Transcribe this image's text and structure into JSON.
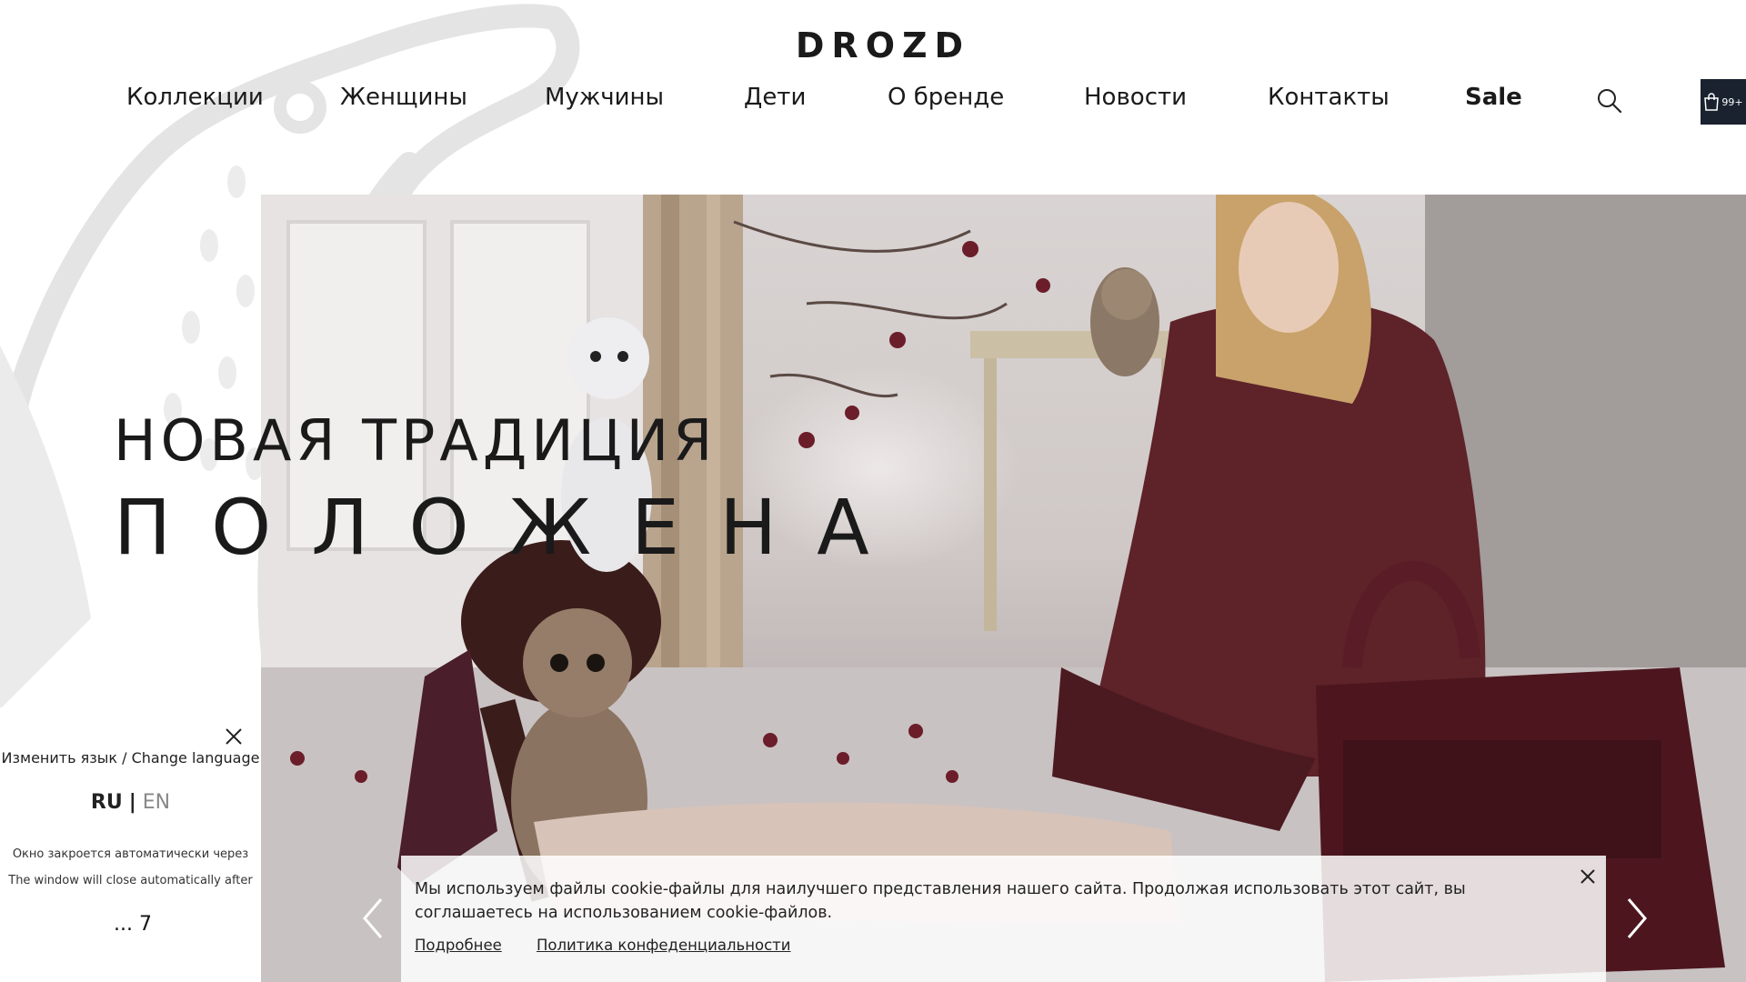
{
  "header": {
    "logo": "DROZD",
    "nav": [
      {
        "label": "Коллекции"
      },
      {
        "label": "Женщины"
      },
      {
        "label": "Мужчины"
      },
      {
        "label": "Дети"
      },
      {
        "label": "О бренде"
      },
      {
        "label": "Новости"
      },
      {
        "label": "Контакты"
      },
      {
        "label": "Sale"
      }
    ],
    "search_icon": "search-icon",
    "cart": {
      "icon": "shopping-bag-icon",
      "count": "99+"
    }
  },
  "hero": {
    "title_line1": "НОВАЯ ТРАДИЦИЯ",
    "title_line2": "ПОЛОЖЕНА",
    "prev_icon": "chevron-left-icon",
    "next_icon": "chevron-right-icon"
  },
  "language_popup": {
    "title": "Изменить язык / Change language",
    "ru": "RU",
    "separator": "|",
    "en": "EN",
    "note_ru": "Окно закроется автоматически через",
    "note_en": "The window will close automatically after",
    "timer": "... 7",
    "close_icon": "close-icon"
  },
  "cookie_banner": {
    "text": "Мы используем файлы cookie-файлы для наилучшего представления нашего сайта. Продолжая использовать этот сайт, вы соглашаетесь на использованием cookie-файлов.",
    "more_link": "Подробнее",
    "policy_link": "Политика конфеденциальности",
    "close_icon": "close-icon"
  },
  "colors": {
    "cart_bg": "#1a2230",
    "text": "#1a1a1a",
    "coat": "#5a1e28"
  }
}
